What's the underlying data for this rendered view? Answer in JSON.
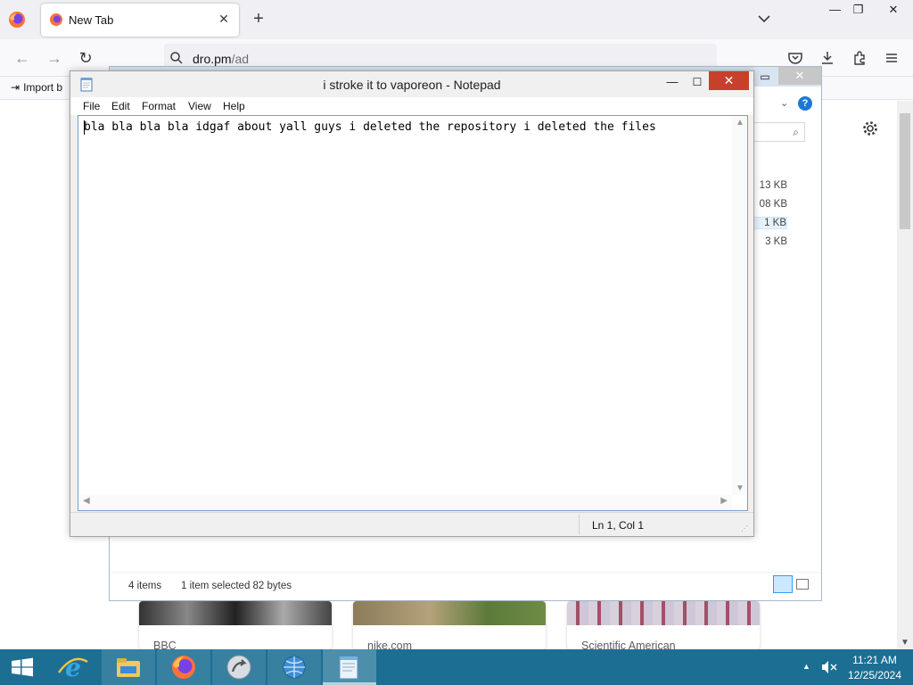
{
  "browser": {
    "tab_title": "New Tab",
    "url_host": "dro.pm",
    "url_path": "/ad",
    "bookmark_import_label": "Import b",
    "tiles": [
      {
        "label": "BBC"
      },
      {
        "label": "nike.com"
      },
      {
        "label": "Scientific American"
      }
    ]
  },
  "explorer": {
    "sizes": [
      "13 KB",
      "08 KB",
      "1 KB",
      "3 KB"
    ],
    "status_items": "4 items",
    "status_selected": "1 item selected  82 bytes"
  },
  "notepad": {
    "title": "i stroke it to vaporeon - Notepad",
    "menu": [
      "File",
      "Edit",
      "Format",
      "View",
      "Help"
    ],
    "content": "bla bla bla bla idgaf about yall guys i deleted the repository i deleted the files",
    "status_position": "Ln 1, Col 1"
  },
  "taskbar": {
    "apps": [
      "internet-explorer",
      "file-explorer",
      "firefox",
      "unknown-app",
      "network-app",
      "notepad"
    ],
    "time": "11:21 AM",
    "date": "12/25/2024"
  },
  "colors": {
    "taskbar": "#1c6f93",
    "notepad_close": "#c7402c",
    "firefox_chrome": "#f0f0f4"
  }
}
